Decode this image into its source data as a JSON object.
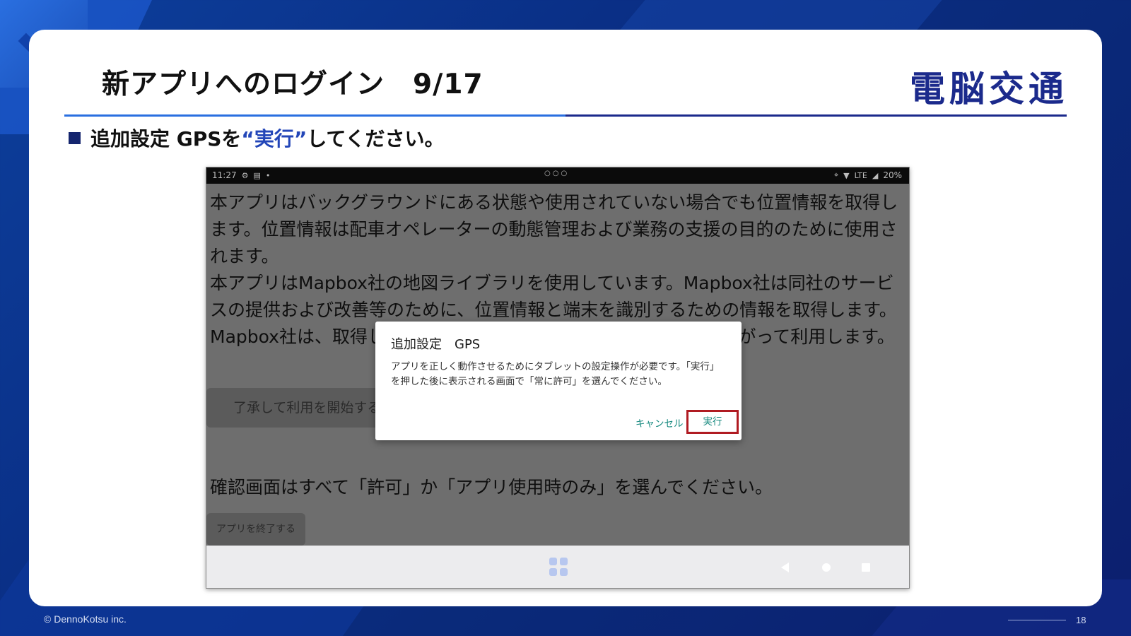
{
  "slide": {
    "title": "新アプリへのログイン　9/17",
    "brand": "電脳交通",
    "bullet_prefix": "追加設定 GPSを",
    "bullet_highlight": "“実行”",
    "bullet_suffix": "してください。"
  },
  "tablet": {
    "status": {
      "time": "11:27",
      "battery": "20%",
      "network": "LTE"
    },
    "paragraph": [
      "本アプリはバックグラウンドにある状態や使用されていない場合でも位置情報を取得します。位置情報は配車オペレーターの動態管理および業務の支援の目的のために使用されます。",
      "本アプリはMapbox社の地図ライブラリを使用しています。Mapbox社は同社のサービスの提供および改善等のために、位置情報と端末を識別するための情報を取得します。Mapbox社は、取得した情報を同社のプライバシーポリシーにしたがって利用します。"
    ],
    "start_button": "了承して利用を開始する",
    "confirm_text": "確認画面はすべて「許可」か「アプリ使用時のみ」を選んでください。",
    "exit_button": "アプリを終了する",
    "dialog": {
      "title": "追加設定　GPS",
      "message": "アプリを正しく動作させるためにタブレットの設定操作が必要です。「実行」を押した後に表示される画面で「常に許可」を選んでください。",
      "cancel": "キャンセル",
      "ok": "実行",
      "highlight_color": "#b01b22"
    }
  },
  "footer": {
    "copyright": "© DennoKotsu inc.",
    "page": "18"
  },
  "colors": {
    "accent": "#2346b8",
    "navy": "#1b2a8c",
    "teal": "#16897f"
  }
}
